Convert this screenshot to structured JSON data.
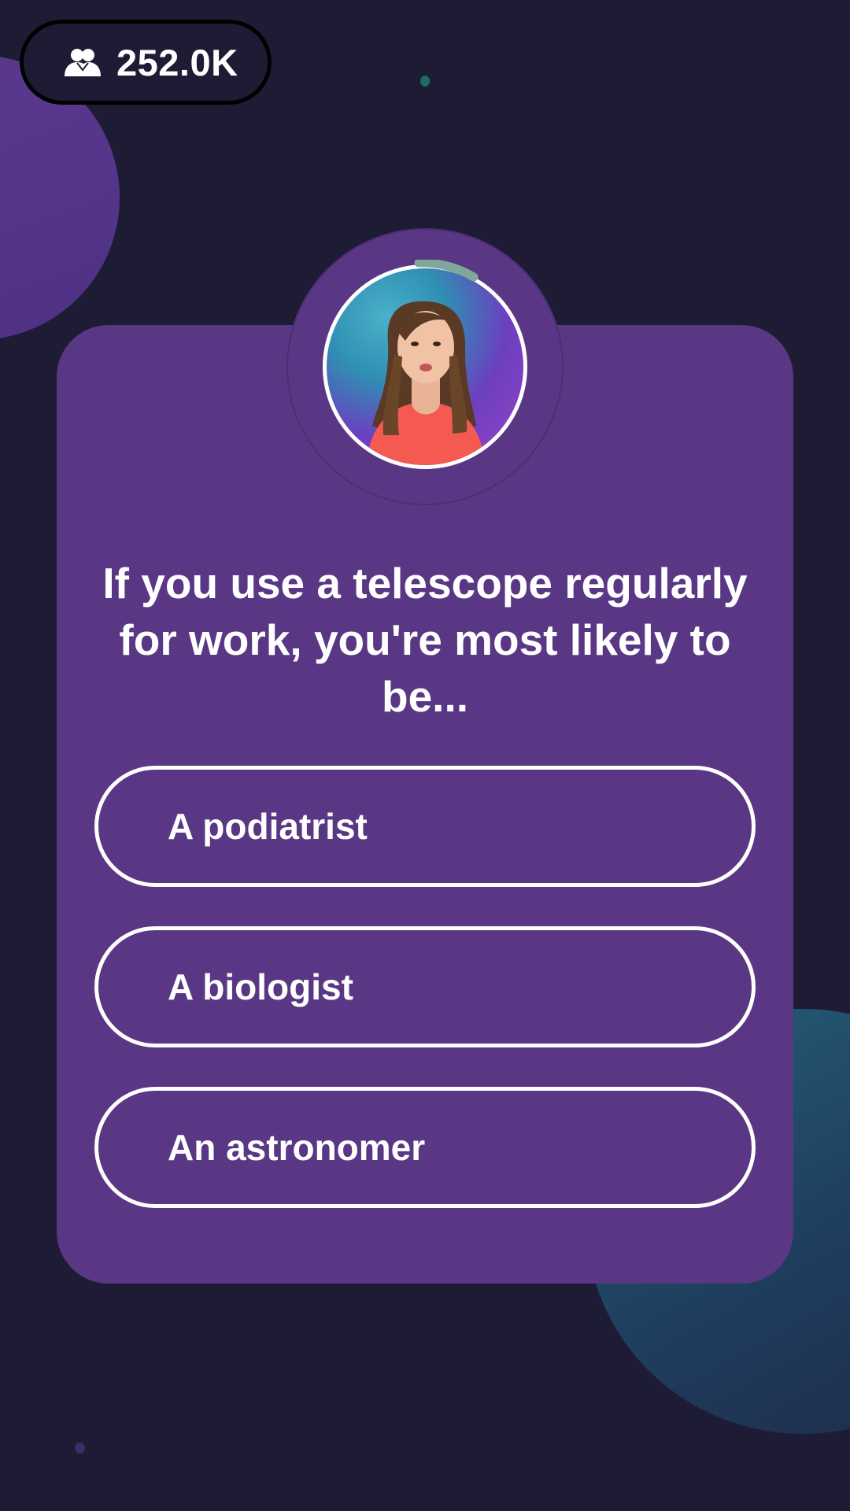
{
  "viewers": {
    "icon": "users-icon",
    "count": "252.0K"
  },
  "host": {
    "icon": "host-video-feed",
    "timer_color": "#7fa89a"
  },
  "question": {
    "text": "If you use a telescope regularly for work, you're most likely to be..."
  },
  "answers": [
    {
      "label": "A podiatrist"
    },
    {
      "label": "A biologist"
    },
    {
      "label": "An astronomer"
    }
  ],
  "colors": {
    "background": "#1e1b35",
    "card": "#5a3785",
    "accent_teal": "#256078",
    "text": "#ffffff"
  }
}
